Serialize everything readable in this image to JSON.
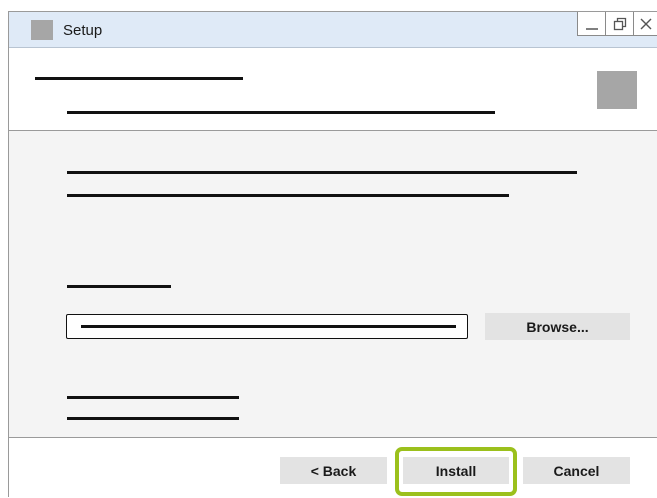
{
  "window": {
    "title": "Setup"
  },
  "buttons": {
    "browse": "Browse...",
    "back": "< Back",
    "install": "Install",
    "cancel": "Cancel"
  },
  "icons": {
    "app": "app-icon",
    "minimize": "minimize-icon",
    "restore": "restore-icon",
    "close": "close-icon",
    "header_logo": "logo-icon"
  },
  "colors": {
    "titlebar": "#dfeaf7",
    "highlight": "#9bc01c",
    "button": "#e3e3e3",
    "body": "#f4f4f4"
  }
}
